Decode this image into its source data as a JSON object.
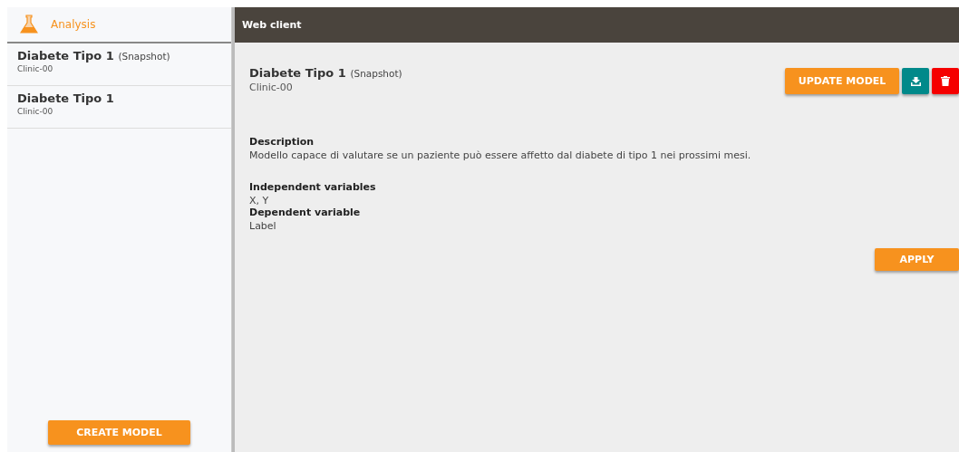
{
  "sidebar": {
    "title": "Analysis",
    "items": [
      {
        "name": "Diabete Tipo 1",
        "tag": "(Snapshot)",
        "clinic": "Clinic-00"
      },
      {
        "name": "Diabete Tipo 1",
        "clinic": "Clinic-00"
      }
    ],
    "button": "CREATE MODEL"
  },
  "header": {
    "title": "Web client"
  },
  "model": {
    "name": "Diabete Tipo 1",
    "tag": "(Snapshot)",
    "clinic": "Clinic-00",
    "update_button": "UPDATE MODEL",
    "description": {
      "label": "Description",
      "value": "Modello capace di valutare se un paziente può essere affetto dal diabete di tipo 1 nei prossimi mesi."
    },
    "variables": [
      {
        "label": "Independent variables",
        "value": "X, Y"
      },
      {
        "label": "Dependent variable",
        "value": "Label"
      }
    ],
    "apply_button": "APPLY"
  }
}
